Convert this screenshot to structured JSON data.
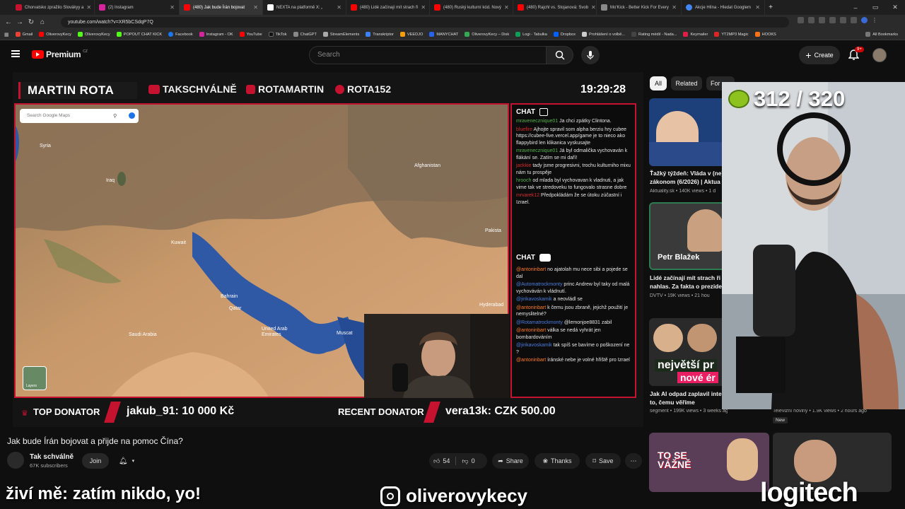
{
  "browser": {
    "tabs": [
      {
        "title": "Chorvatsko zpražilo Slovákyy a ",
        "color": "#c4122f"
      },
      {
        "title": "(2) Instagram",
        "color": "#d6249f"
      },
      {
        "title": "(480) Jak bude Írán bojovat",
        "color": "#ff0000"
      },
      {
        "title": "NEXTA na platformě X: „",
        "color": "#ffffff"
      },
      {
        "title": "(480) Lidé začínají mít strach ři",
        "color": "#ff0000"
      },
      {
        "title": "(480) Ruský kulturní kód. Nový",
        "color": "#ff0000"
      },
      {
        "title": "(480) Rajchl vs. Stojanová: Svob",
        "color": "#ff0000"
      },
      {
        "title": "Mo'Kick - Better Kick For Every",
        "color": "#888888"
      },
      {
        "title": "Akcje Hlína - Hledat Googlem",
        "color": "#4285f4"
      }
    ],
    "url": "youtube.com/watch?v=XR5bCSdqP7Q",
    "bookmarks": [
      "Gmail",
      "OliverovyKecy",
      "OliverovyKecy",
      "POPOUT CHAT KICK",
      "Facebook",
      "Instagram - OK",
      "YouTube",
      "TikTok",
      "ChatGPT",
      "StreamElements",
      "Transkriptor",
      "VEEDJO",
      "MANYCHAT",
      "OliverovyKecy – Disk",
      "Logi - Tabulka",
      "Dropbox",
      "Prohlášení o volbě...",
      "Rating médií - Nada...",
      "Keymailer",
      "YT2MP3 Magic",
      "HOOKS"
    ],
    "all_bookmarks": "All Bookmarks"
  },
  "yt": {
    "logo": "Premium",
    "logo_sup": "CZ",
    "search_placeholder": "Search",
    "create": "Create",
    "notif_badge": "9+"
  },
  "stream": {
    "name": "MARTIN ROTA",
    "socials": [
      "TAKSCHVÁLNĚ",
      "ROTAMARTIN",
      "ROTA152"
    ],
    "clock": "19:29:28",
    "map_search": "Search Google Maps",
    "map_labels": [
      "Syria",
      "Iraq",
      "Afghanistan",
      "Kuwait",
      "Bahrain",
      "Qatar",
      "Saudi Arabia",
      "United Arab Emirates",
      "Muscat",
      "Pakista",
      "Hyderabad",
      "Layers"
    ],
    "chat_twitch_title": "CHAT",
    "chat_twitch": [
      {
        "user": "mravenecznique01",
        "ucls": "u-g",
        "text": "Ja chci zpátky Clintona."
      },
      {
        "user": "bluefire",
        "ucls": "u-r",
        "text": "Ajhojte spravil som alpha berziu hry cubee https://cubee-five.vercel.app/game je to nieco ako flappybird len klikanica vyskusajte"
      },
      {
        "user": "mravenecznique01",
        "ucls": "u-g",
        "text": "Já byl odmalička vychovaván k flákání se. Zatím se mi daří!"
      },
      {
        "user": "jackkie",
        "ucls": "u-r",
        "text": "tady jsme progresivni, trochu kulturniho mixu nám tu prospěje"
      },
      {
        "user": "hrooch",
        "ucls": "u-g",
        "text": "od mlada byl vychovavan k vladnuti, a jak vime tak ve stredoveku to fungovalo strasne dobre"
      },
      {
        "user": "mrvarek12",
        "ucls": "u-r",
        "text": "Předpokládám že se útoku zúčastní i Izrael."
      }
    ],
    "chat_yt_title": "CHAT",
    "chat_yt": [
      {
        "user": "@antoninbart",
        "ucls": "u-o",
        "text": "no ajatolah mu nece sibi a pojede se dal"
      },
      {
        "user": "@Automatrockmonty",
        "ucls": "u-b",
        "text": "princ Andrew byl taky od malá vychováván k vládnutí."
      },
      {
        "user": "@jirikavoskamik",
        "ucls": "u-b",
        "text": "a neovládl se"
      },
      {
        "user": "@antoninbart",
        "ucls": "u-o",
        "text": "k čemu jsou zbraně, jejichž použití je nemyslitelné?"
      },
      {
        "user": "@Rotamatrockmonty",
        "ucls": "u-b",
        "text": "@lemonjoe8831 zabil"
      },
      {
        "user": "@antoninbart",
        "ucls": "u-o",
        "text": "válka se nedá vyhrát jen bombardováním"
      },
      {
        "user": "@jirikavoskamik",
        "ucls": "u-b",
        "text": "tak spíš se bavíme o poškození ne ?"
      },
      {
        "user": "@antoninbart",
        "ucls": "u-o",
        "text": "íránské nebe je volné hřiště pro Izrael"
      }
    ],
    "top_donator_label": "TOP DONATOR",
    "top_donator_value": "jakub_91: 10 000 Kč",
    "recent_donator_label": "RECENT DONATOR",
    "recent_donator_value": "vera13k: CZK 500.00"
  },
  "video": {
    "title": "Jak bude Írán bojovat a přijde na pomoc Čína?",
    "channel": "Tak schválně",
    "subs": "67K subscribers",
    "join": "Join",
    "likes": "54",
    "dislikes": "0",
    "share": "Share",
    "thanks": "Thanks",
    "save": "Save"
  },
  "sidebar": {
    "chips": [
      "All",
      "Related",
      "For y"
    ],
    "videos": [
      {
        "title": "Ťažký týždeň: Vláda v (ne)",
        "title2": "zákonom (6/2026) | Aktua",
        "meta": "Aktuality.sk • 140K views • 1 d"
      },
      {
        "title": "Lidé začínají mít strach ři",
        "title2": "nahlas. Za fakta o preziden",
        "meta": "DVTV • 19K views • 21 hou",
        "thumb_text": "Petr Blažek"
      },
      {
        "title": "Jak AI odpad zaplavil inter",
        "title2": "to, čemu věříme",
        "meta": "segment • 199K views • 3 weeks ago",
        "thumb_text": "největší pr",
        "thumb_text2": "nové ér"
      }
    ],
    "extra_meta": "Televizní noviny • 1.9K views • 2 hours ago",
    "new_badge": "New",
    "thumb4_text": "TO SE VÁŽNĚ"
  },
  "facecam": {
    "score": "312 / 320"
  },
  "overlay": {
    "bottom_text": "živí mě: zatím nikdo, yo!",
    "instagram": "oliverovykecy",
    "brand": "logitech"
  }
}
